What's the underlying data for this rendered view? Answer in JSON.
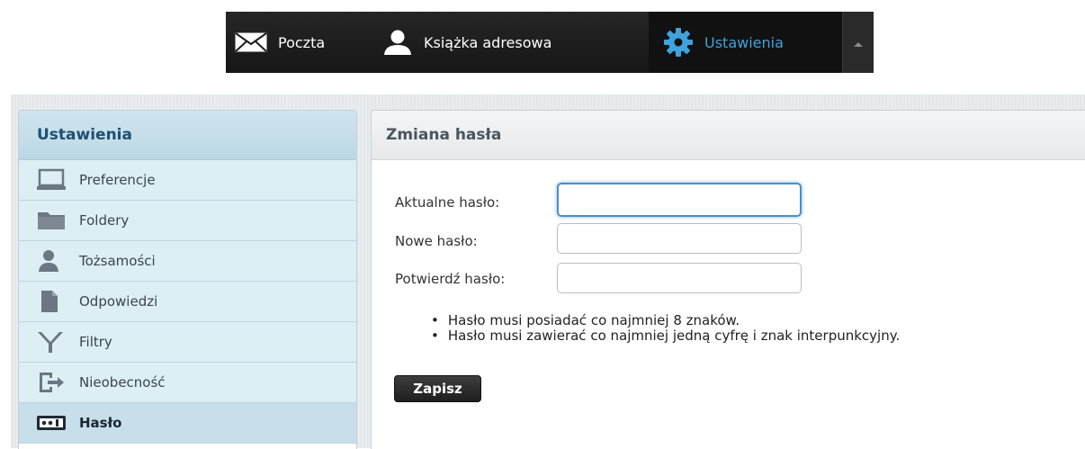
{
  "topnav": {
    "items": [
      {
        "label": "Poczta",
        "icon": "mail-icon"
      },
      {
        "label": "Książka adresowa",
        "icon": "person-icon"
      },
      {
        "label": "Ustawienia",
        "icon": "gear-icon",
        "active": true
      }
    ],
    "more_icon": "caret-up-icon",
    "active_color": "#3ea3df"
  },
  "sidebar": {
    "title": "Ustawienia",
    "items": [
      {
        "label": "Preferencje",
        "icon": "laptop-icon"
      },
      {
        "label": "Foldery",
        "icon": "folder-icon"
      },
      {
        "label": "Tożsamości",
        "icon": "person-icon"
      },
      {
        "label": "Odpowiedzi",
        "icon": "document-icon"
      },
      {
        "label": "Filtry",
        "icon": "filter-icon"
      },
      {
        "label": "Nieobecność",
        "icon": "exit-icon"
      },
      {
        "label": "Hasło",
        "icon": "password-icon",
        "active": true
      }
    ]
  },
  "main": {
    "title": "Zmiana hasła",
    "fields": [
      {
        "label": "Aktualne hasło:",
        "value": ""
      },
      {
        "label": "Nowe hasło:",
        "value": ""
      },
      {
        "label": "Potwierdź hasło:",
        "value": ""
      }
    ],
    "hints": [
      "Hasło musi posiadać co najmniej 8 znaków.",
      "Hasło musi zawierać co najmniej jedną cyfrę i znak interpunkcyjny."
    ],
    "save_label": "Zapisz"
  }
}
